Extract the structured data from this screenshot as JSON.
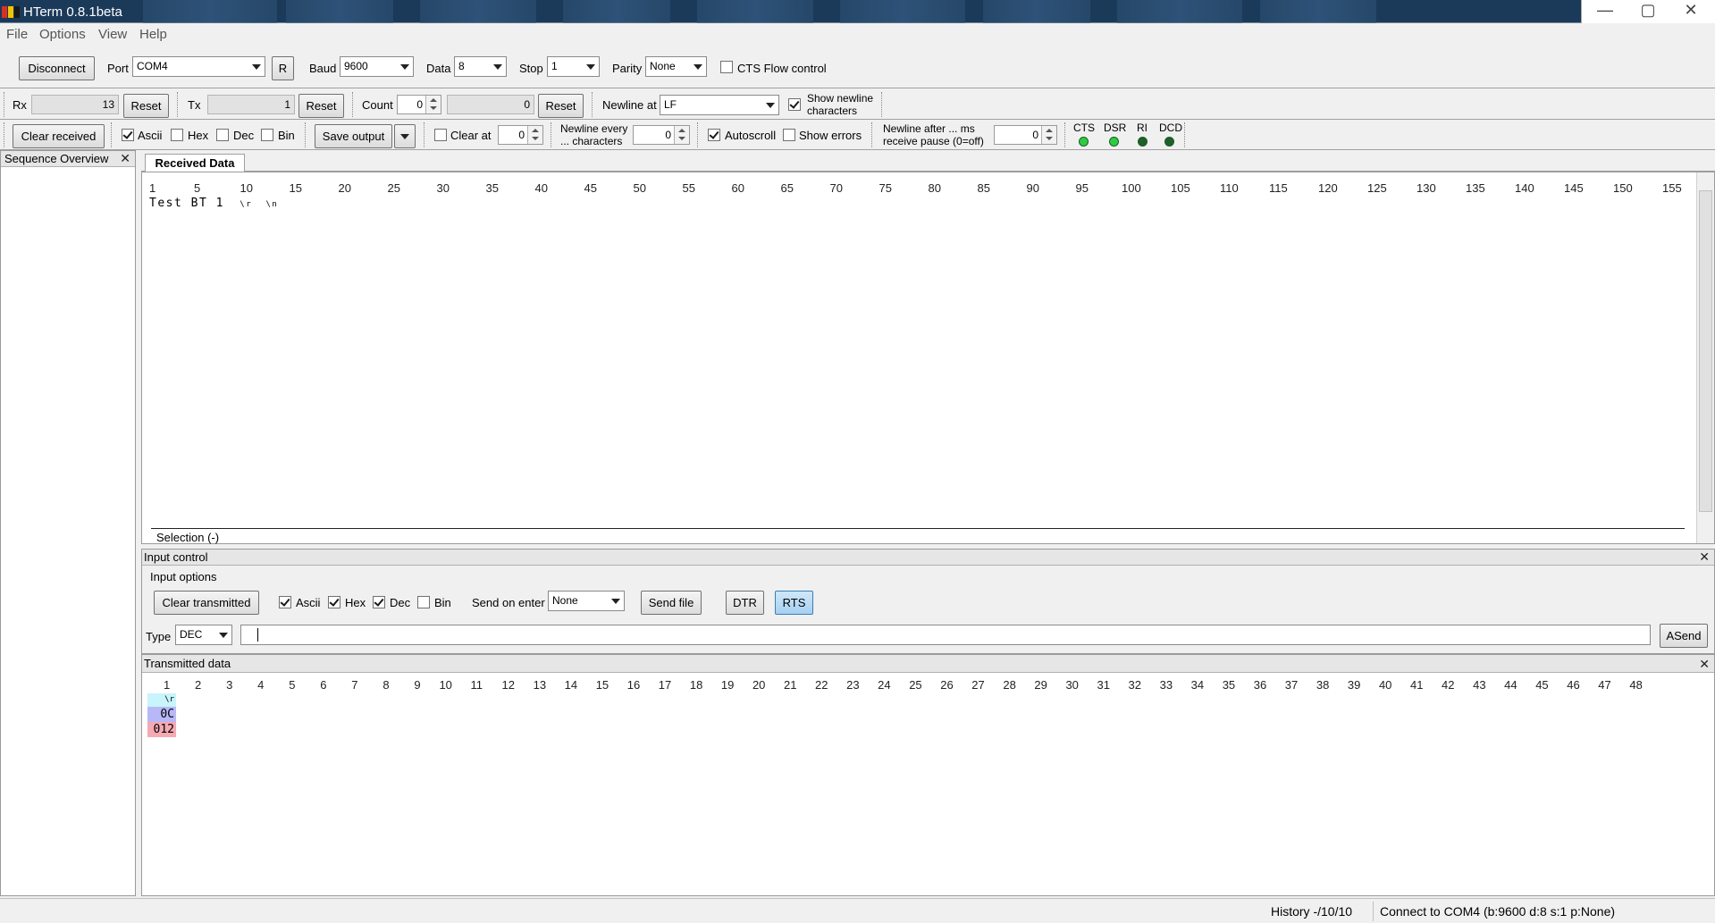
{
  "window": {
    "title": "HTerm 0.8.1beta",
    "controls": [
      "—",
      "▢",
      "✕"
    ]
  },
  "menu": [
    "File",
    "Options",
    "View",
    "Help"
  ],
  "connection": {
    "disconnect_label": "Disconnect",
    "port_label": "Port",
    "port_value": "COM4",
    "refresh_label": "R",
    "baud_label": "Baud",
    "baud_value": "9600",
    "data_label": "Data",
    "data_value": "8",
    "stop_label": "Stop",
    "stop_value": "1",
    "parity_label": "Parity",
    "parity_value": "None",
    "cts_flow_label": "CTS Flow control"
  },
  "counters": {
    "rx_label": "Rx",
    "rx_value": "13",
    "rx_reset": "Reset",
    "tx_label": "Tx",
    "tx_value": "1",
    "tx_reset": "Reset",
    "count_label": "Count",
    "count_value": "0",
    "count_total": "0",
    "count_reset": "Reset",
    "newline_at_label": "Newline at",
    "newline_at_value": "LF",
    "show_newline_line1": "Show newline",
    "show_newline_line2": "characters"
  },
  "receive_options": {
    "clear_received": "Clear received",
    "ascii": "Ascii",
    "hex": "Hex",
    "dec": "Dec",
    "bin": "Bin",
    "save_output": "Save output",
    "clear_at": "Clear at",
    "clear_at_value": "0",
    "newline_every_line1": "Newline every",
    "newline_every_line2": "... characters",
    "newline_every_value": "0",
    "autoscroll": "Autoscroll",
    "show_errors": "Show errors",
    "newline_after_line1": "Newline after ... ms",
    "newline_after_line2": "receive pause (0=off)",
    "newline_after_value": "0",
    "leds": [
      "CTS",
      "DSR",
      "RI",
      "DCD"
    ]
  },
  "sequence_overview": {
    "title": "Sequence Overview"
  },
  "received": {
    "tab": "Received Data",
    "ruler": [
      "1",
      "5",
      "10",
      "15",
      "20",
      "25",
      "30",
      "35",
      "40",
      "45",
      "50",
      "55",
      "60",
      "65",
      "70",
      "75",
      "80",
      "85",
      "90",
      "95",
      "100",
      "105",
      "110",
      "115",
      "120",
      "125",
      "130",
      "135",
      "140",
      "145",
      "150",
      "155"
    ],
    "content": "Test BT 1",
    "cr": "\\r",
    "lf": "\\n",
    "selection": "Selection (-)"
  },
  "input_control": {
    "title": "Input control",
    "options_label": "Input options",
    "clear_transmitted": "Clear transmitted",
    "ascii": "Ascii",
    "hex": "Hex",
    "dec": "Dec",
    "bin": "Bin",
    "send_on_enter_label": "Send on enter",
    "send_on_enter_value": "None",
    "send_file": "Send file",
    "dtr": "DTR",
    "rts": "RTS",
    "type_label": "Type",
    "type_value": "DEC",
    "asend": "ASend"
  },
  "transmitted": {
    "title": "Transmitted data",
    "ruler": [
      "1",
      "2",
      "3",
      "4",
      "5",
      "6",
      "7",
      "8",
      "9",
      "10",
      "11",
      "12",
      "13",
      "14",
      "15",
      "16",
      "17",
      "18",
      "19",
      "20",
      "21",
      "22",
      "23",
      "24",
      "25",
      "26",
      "27",
      "28",
      "29",
      "30",
      "31",
      "32",
      "33",
      "34",
      "35",
      "36",
      "37",
      "38",
      "39",
      "40",
      "41",
      "42",
      "43",
      "44",
      "45",
      "46",
      "47",
      "48"
    ],
    "ascii_cell": "\\r",
    "hex_cell": "0C",
    "dec_cell": "012"
  },
  "status": {
    "history": "History -/10/10",
    "connection": "Connect to COM4 (b:9600 d:8 s:1 p:None)"
  },
  "colors": {
    "ascii_bg": "#c8f4fb",
    "hex_bg": "#b8b8f8",
    "dec_bg": "#f5a9b3",
    "led_green": "#2ecc40",
    "led_dark": "#1f5f2a"
  }
}
